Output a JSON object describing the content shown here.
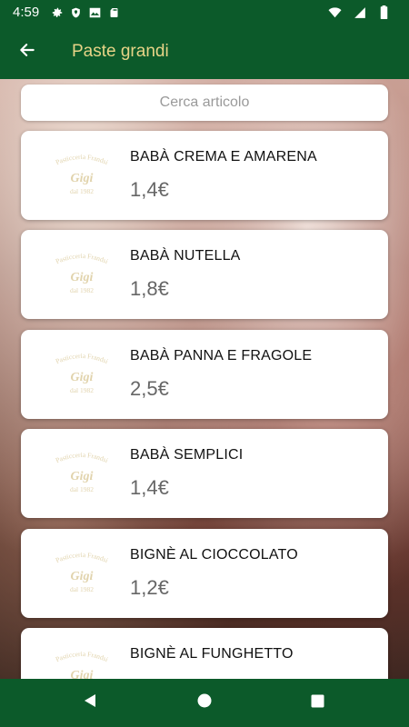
{
  "status_bar": {
    "time": "4:59",
    "icons": [
      "settings-icon",
      "shield-icon",
      "mail-icon",
      "sd-card-icon"
    ],
    "right_icons": [
      "wifi-icon",
      "signal-icon",
      "battery-icon"
    ]
  },
  "app_bar": {
    "title": "Paste grandi",
    "back_icon": "arrow-left-icon"
  },
  "colors": {
    "primary": "#0c5a2a",
    "title_text": "#e7d487",
    "price_text": "#666666"
  },
  "search": {
    "placeholder": "Cerca articolo",
    "value": ""
  },
  "logo_text": {
    "line1": "Pasticceria Frandsi",
    "line2": "Gigi",
    "line3": "dal 1982"
  },
  "items": [
    {
      "name": "BABÀ CREMA E AMARENA",
      "price": "1,4€"
    },
    {
      "name": "BABÀ NUTELLA",
      "price": "1,8€"
    },
    {
      "name": "BABÀ PANNA E FRAGOLE",
      "price": "2,5€"
    },
    {
      "name": "BABÀ SEMPLICI",
      "price": "1,4€"
    },
    {
      "name": "BIGNÈ AL CIOCCOLATO",
      "price": "1,2€"
    },
    {
      "name": "BIGNÈ AL FUNGHETTO",
      "price": ""
    }
  ],
  "nav_bar": {
    "buttons": [
      "back-triangle-icon",
      "home-circle-icon",
      "recents-square-icon"
    ]
  }
}
